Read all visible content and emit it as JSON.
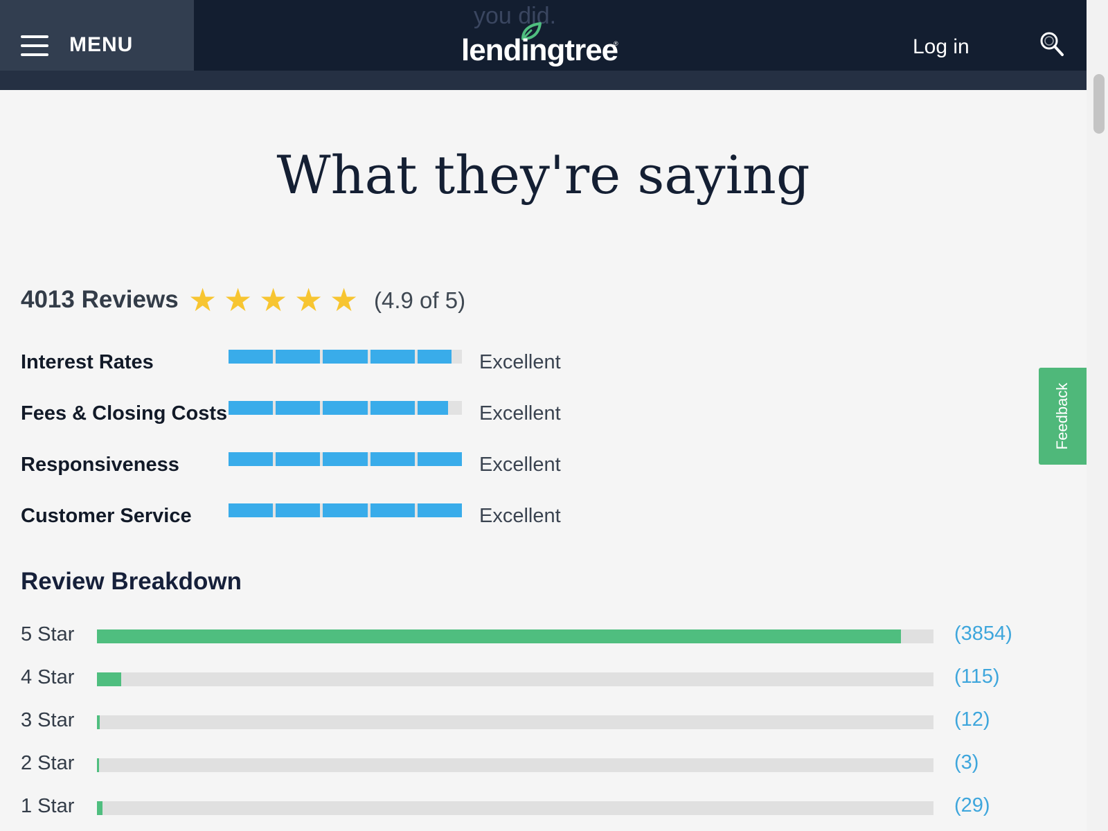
{
  "header": {
    "menu_label": "MENU",
    "ghost_text": "you did.",
    "logo_text": "lendingtree",
    "logo_tm": "®",
    "login_label": "Log in"
  },
  "colors": {
    "header_bg": "#131e30",
    "accent_blue": "#39acea",
    "accent_green": "#4fbe7f",
    "star_gold": "#f7c531",
    "link_blue": "#3ea6dc"
  },
  "icons": {
    "menu": "hamburger-icon",
    "search": "search-icon",
    "logo": "leaf-icon",
    "rating": "star-icon"
  },
  "feedback": {
    "label": "Feedback"
  },
  "section": {
    "title": "What they're saying"
  },
  "summary": {
    "reviews_label": "4013 Reviews",
    "stars_shown": 5,
    "rating_text": "(4.9 of 5)"
  },
  "categories": [
    {
      "label": "Interest Rates",
      "value": "Excellent",
      "score_fraction": 0.955
    },
    {
      "label": "Fees & Closing Costs",
      "value": "Excellent",
      "score_fraction": 0.94
    },
    {
      "label": "Responsiveness",
      "value": "Excellent",
      "score_fraction": 1.0
    },
    {
      "label": "Customer Service",
      "value": "Excellent",
      "score_fraction": 1.0
    }
  ],
  "breakdown": {
    "title": "Review Breakdown",
    "rows": [
      {
        "label": "5 Star",
        "count": "(3854)",
        "fraction": 0.961
      },
      {
        "label": "4 Star",
        "count": "(115)",
        "fraction": 0.029
      },
      {
        "label": "3 Star",
        "count": "(12)",
        "fraction": 0.003
      },
      {
        "label": "2 Star",
        "count": "(3)",
        "fraction": 0.001
      },
      {
        "label": "1 Star",
        "count": "(29)",
        "fraction": 0.007
      }
    ]
  }
}
